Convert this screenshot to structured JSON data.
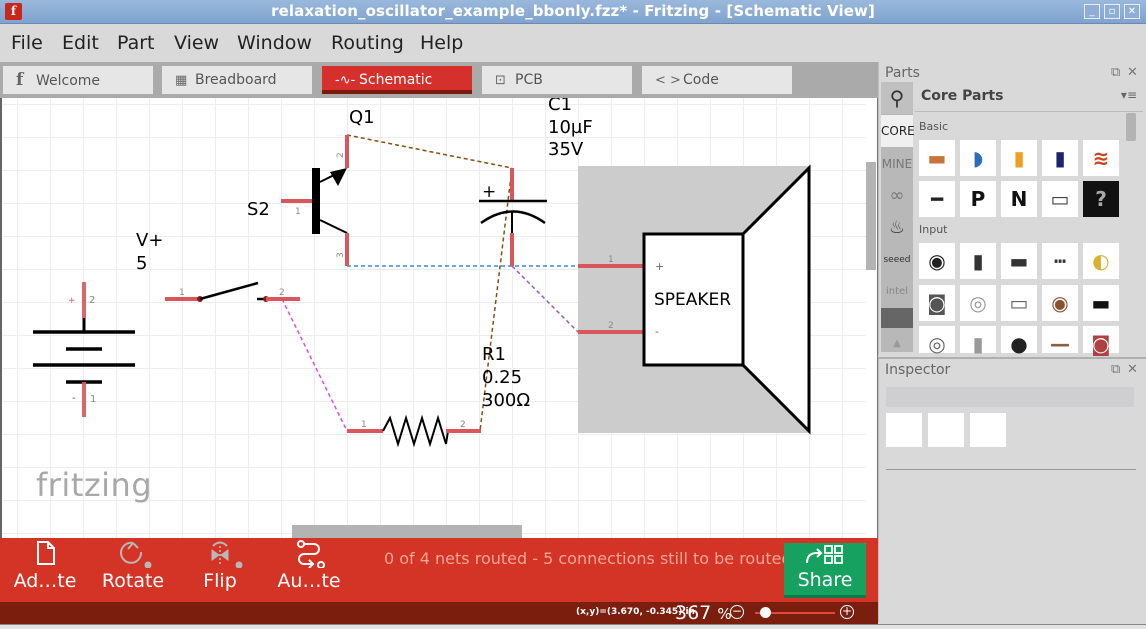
{
  "window": {
    "title": "relaxation_oscillator_example_bbonly.fzz* - Fritzing - [Schematic View]",
    "app_icon": "f",
    "controls": [
      "minimize",
      "maximize",
      "close"
    ]
  },
  "menubar": {
    "items": [
      "File",
      "Edit",
      "Part",
      "View",
      "Window",
      "Routing",
      "Help"
    ]
  },
  "tabs": [
    {
      "label": "Welcome",
      "icon": "fritzing-f-icon",
      "glyph": "f",
      "active": false
    },
    {
      "label": "Breadboard",
      "icon": "breadboard-icon",
      "glyph": "▦",
      "active": false
    },
    {
      "label": "Schematic",
      "icon": "resistor-symbol-icon",
      "glyph": "-∿-",
      "active": true
    },
    {
      "label": "PCB",
      "icon": "pcb-icon",
      "glyph": "⊡",
      "active": false
    },
    {
      "label": "Code",
      "icon": "code-brackets-icon",
      "glyph": "< >",
      "active": false
    }
  ],
  "schematic": {
    "battery": {
      "label": "V+",
      "value": "5",
      "pin_plus": "+",
      "pin_plus_num": "2",
      "pin_minus": "-",
      "pin_minus_num": "1"
    },
    "switch": {
      "label": "S2",
      "pin1": "1",
      "pin2": "2"
    },
    "transistor": {
      "label": "Q1",
      "base_net_label": "S2",
      "pin_base": "1",
      "pin_emitter": "2",
      "pin_collector": "3"
    },
    "capacitor": {
      "label": "C1",
      "capacitance": "10µF",
      "voltage": "35V",
      "polarity": "+",
      "pin_pos": "2",
      "pin_neg": "1"
    },
    "resistor": {
      "label": "R1",
      "power": "0.25",
      "resistance": "300Ω",
      "pin1": "1",
      "pin2": "2"
    },
    "speaker": {
      "label": "SPEAKER",
      "pin1": "1",
      "pin2": "2",
      "pin1_sign": "+",
      "pin2_sign": "-"
    },
    "ratsnest_colors": {
      "brown": "#8a4b12",
      "blue": "#3a8ad8",
      "magenta": "#e04ed8",
      "purple": "#a05ab5"
    },
    "logo": "fritzing"
  },
  "toolbar": {
    "buttons": [
      {
        "label": "Ad…te",
        "icon": "add-note-icon",
        "enabled": true
      },
      {
        "label": "Rotate",
        "icon": "rotate-icon",
        "enabled": false
      },
      {
        "label": "Flip",
        "icon": "flip-icon",
        "enabled": false
      },
      {
        "label": "Au…te",
        "icon": "autoroute-icon",
        "enabled": true
      }
    ],
    "routing_status": "0 of 4 nets routed - 5 connections still to be routed",
    "share_label": "Share"
  },
  "statusbar": {
    "coords": "(x,y)=(3.670, -0.345) in",
    "zoom_value": "367",
    "zoom_unit": "%",
    "zoom_slider_fraction": 0.1
  },
  "parts_panel": {
    "title": "Parts",
    "bin_title": "Core Parts",
    "bins": [
      "search",
      "CORE",
      "MINE",
      "arduino",
      "sparkfun",
      "seeed",
      "intel",
      "more"
    ],
    "sections": [
      {
        "name": "Basic",
        "items": [
          "resistor",
          "ceramic-capacitor",
          "tantalum-capacitor",
          "electrolytic-capacitor",
          "inductor",
          "diode",
          "pnp-transistor",
          "npn-transistor",
          "fet",
          "mystery-part"
        ]
      },
      {
        "name": "Input",
        "items": [
          "potentiometer",
          "slide-potentiometer",
          "rotary-potentiometer",
          "header-strip",
          "piezo",
          "rotary-encoder",
          "dip-rotary-switch",
          "button-smd",
          "pushbutton",
          "slide-switch",
          "knob-pot",
          "tilt-switch",
          "microphone",
          "wire",
          "photocell"
        ]
      }
    ]
  },
  "inspector_panel": {
    "title": "Inspector"
  },
  "colors": {
    "accent_red": "#d43425",
    "status_dark_red": "#7c1e0e",
    "share_green": "#16a161",
    "pin_red": "#d9575a"
  }
}
